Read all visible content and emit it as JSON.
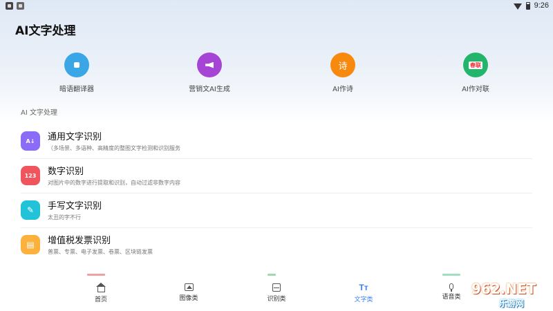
{
  "status_bar": {
    "time": "9:26"
  },
  "header": {
    "title": "AI文字处理"
  },
  "quick_actions": [
    {
      "label": "暗语翻译器",
      "color": "#3aa6e6",
      "icon": "dot-icon"
    },
    {
      "label": "营销文AI生成",
      "color": "#a644d6",
      "icon": "megaphone-icon"
    },
    {
      "label": "AI作诗",
      "color": "#f7890f",
      "icon": "poem-icon",
      "glyph": "诗"
    },
    {
      "label": "AI作对联",
      "color": "#25b46c",
      "icon": "couplet-icon",
      "glyph": "春联"
    }
  ],
  "section": {
    "label": "AI 文字处理"
  },
  "list": [
    {
      "title": "通用文字识别",
      "desc": "（多场景、多语种、高精度的整图文字检测和识别服务",
      "color": "#8b6cf6",
      "icon": "text-recognition-icon",
      "glyph": "A↓"
    },
    {
      "title": "数字识别",
      "desc": "对图片中的数字进行提取和识别，自动过滤非数字内容",
      "color": "#f0555e",
      "icon": "number-icon",
      "glyph": "123"
    },
    {
      "title": "手写文字识别",
      "desc": "太丑的字不行",
      "color": "#22c3d8",
      "icon": "pen-icon",
      "glyph": "✎"
    },
    {
      "title": "增值税发票识别",
      "desc": "普票、专票、电子发票、卷票、区块链发票",
      "color": "#fbb13c",
      "icon": "invoice-icon",
      "glyph": "▤"
    }
  ],
  "bottom_nav": [
    {
      "label": "首页",
      "icon": "home-icon",
      "active": false
    },
    {
      "label": "图像类",
      "icon": "image-icon",
      "active": false
    },
    {
      "label": "识别类",
      "icon": "scan-icon",
      "active": false
    },
    {
      "label": "文字类",
      "icon": "text-icon",
      "glyph": "Tт",
      "active": true
    },
    {
      "label": "语音类",
      "icon": "mic-icon",
      "active": false
    }
  ],
  "watermark": {
    "main": "962.NET",
    "sub": "乐游网"
  },
  "colors": {
    "accent": "#3b82f6"
  }
}
